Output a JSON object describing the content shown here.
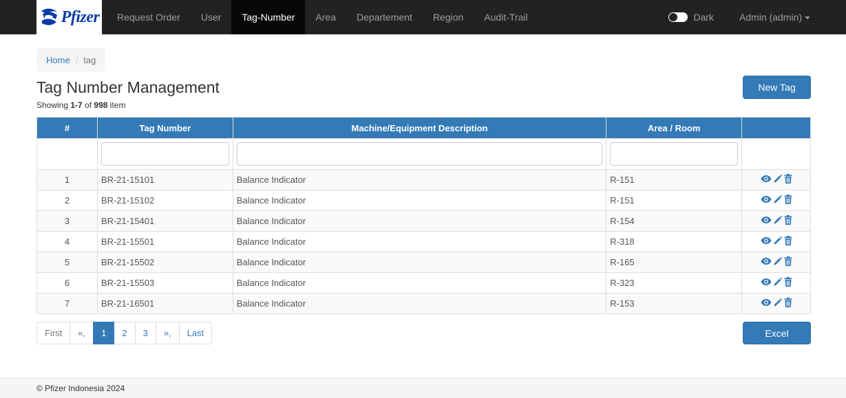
{
  "app": {
    "brand": "Pfizer",
    "brand_color": "#0a3ca8",
    "accent": "#337ab7"
  },
  "nav": {
    "items": [
      {
        "label": "Request Order"
      },
      {
        "label": "User"
      },
      {
        "label": "Tag-Number",
        "active": true
      },
      {
        "label": "Area"
      },
      {
        "label": "Departement"
      },
      {
        "label": "Region"
      },
      {
        "label": "Audit-Trail"
      }
    ],
    "dark_label": "Dark",
    "user_label": "Admin (admin)"
  },
  "breadcrumb": {
    "home": "Home",
    "separator": "/",
    "current": "tag"
  },
  "page": {
    "title": "Tag Number Management",
    "summary_prefix": "Showing ",
    "summary_range": "1-7",
    "summary_of": " of ",
    "summary_total": "998",
    "summary_suffix": " item",
    "new_button": "New Tag",
    "excel_button": "Excel"
  },
  "table": {
    "headers": [
      "#",
      "Tag Number",
      "Machine/Equipment Description",
      "Area / Room",
      ""
    ],
    "rows": [
      {
        "num": "1",
        "tag": "BR-21-15101",
        "desc": "Balance Indicator",
        "area": "R-151"
      },
      {
        "num": "2",
        "tag": "BR-21-15102",
        "desc": "Balance Indicator",
        "area": "R-151"
      },
      {
        "num": "3",
        "tag": "BR-21-15401",
        "desc": "Balance Indicator",
        "area": "R-154"
      },
      {
        "num": "4",
        "tag": "BR-21-15501",
        "desc": "Balance Indicator",
        "area": "R-318"
      },
      {
        "num": "5",
        "tag": "BR-21-15502",
        "desc": "Balance Indicator",
        "area": "R-165"
      },
      {
        "num": "6",
        "tag": "BR-21-15503",
        "desc": "Balance Indicator",
        "area": "R-323"
      },
      {
        "num": "7",
        "tag": "BR-21-16501",
        "desc": "Balance Indicator",
        "area": "R-153"
      }
    ],
    "row_actions": [
      "view-icon",
      "edit-icon",
      "delete-icon"
    ]
  },
  "pagination": {
    "first": "First",
    "prev": "«,",
    "pages": [
      "1",
      "2",
      "3"
    ],
    "active": "1",
    "next": "»,",
    "last": "Last"
  },
  "footer": {
    "text": "© Pfizer Indonesia 2024"
  }
}
